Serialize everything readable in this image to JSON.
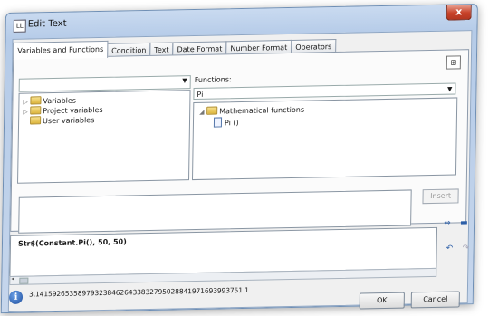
{
  "window": {
    "title": "Edit Text",
    "close_label": "x"
  },
  "tabs": [
    {
      "label": "Variables and Functions"
    },
    {
      "label": "Condition"
    },
    {
      "label": "Text"
    },
    {
      "label": "Date Format"
    },
    {
      "label": "Number Format"
    },
    {
      "label": "Operators"
    }
  ],
  "left_panel": {
    "dropdown_value": "",
    "tree": [
      {
        "label": "Variables"
      },
      {
        "label": "Project variables"
      },
      {
        "label": "User variables"
      }
    ]
  },
  "right_panel": {
    "label": "Functions:",
    "dropdown_value": "Pi",
    "tree": [
      {
        "label": "Mathematical functions"
      },
      {
        "label": "Pi ()"
      }
    ]
  },
  "insert_button": "Insert",
  "expression": "Str$(Constant.Pi(), 50, 50)",
  "result": "3,1415926535897932384626433832795028841971693993751 1",
  "buttons": {
    "ok": "OK",
    "cancel": "Cancel"
  },
  "icons": [
    "window-icon",
    "close-icon",
    "tree-view-icon",
    "folder-icon",
    "function-icon",
    "undo-icon",
    "redo-icon",
    "info-icon"
  ]
}
